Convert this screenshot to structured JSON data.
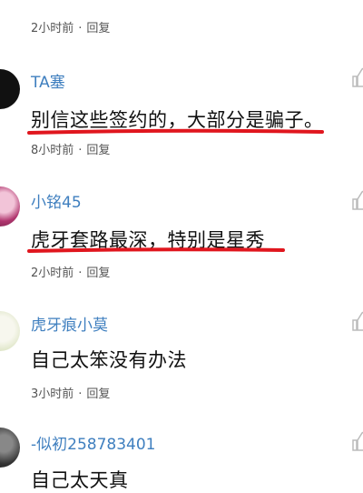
{
  "top_meta": {
    "time": "2小时前",
    "sep": "·",
    "reply": "回复"
  },
  "comments": [
    {
      "username": "TA塞",
      "text": "别信这些签约的，大部分是骗子。",
      "time": "8小时前",
      "sep": "·",
      "reply": "回复"
    },
    {
      "username": "小铭45",
      "text": "虎牙套路最深，特别是星秀",
      "time": "2小时前",
      "sep": "·",
      "reply": "回复"
    },
    {
      "username": "虎牙痕小莫",
      "text": "自己太笨没有办法",
      "time": "3小时前",
      "sep": "·",
      "reply": "回复"
    },
    {
      "username": "-似初258783401",
      "text": "自己太天真"
    }
  ],
  "colors": {
    "username": "#3f7fbf",
    "underline": "#e0161e",
    "meta": "#555555",
    "like_icon": "#bbbbbb"
  },
  "icons": {
    "like": "thumbs-up-icon"
  }
}
